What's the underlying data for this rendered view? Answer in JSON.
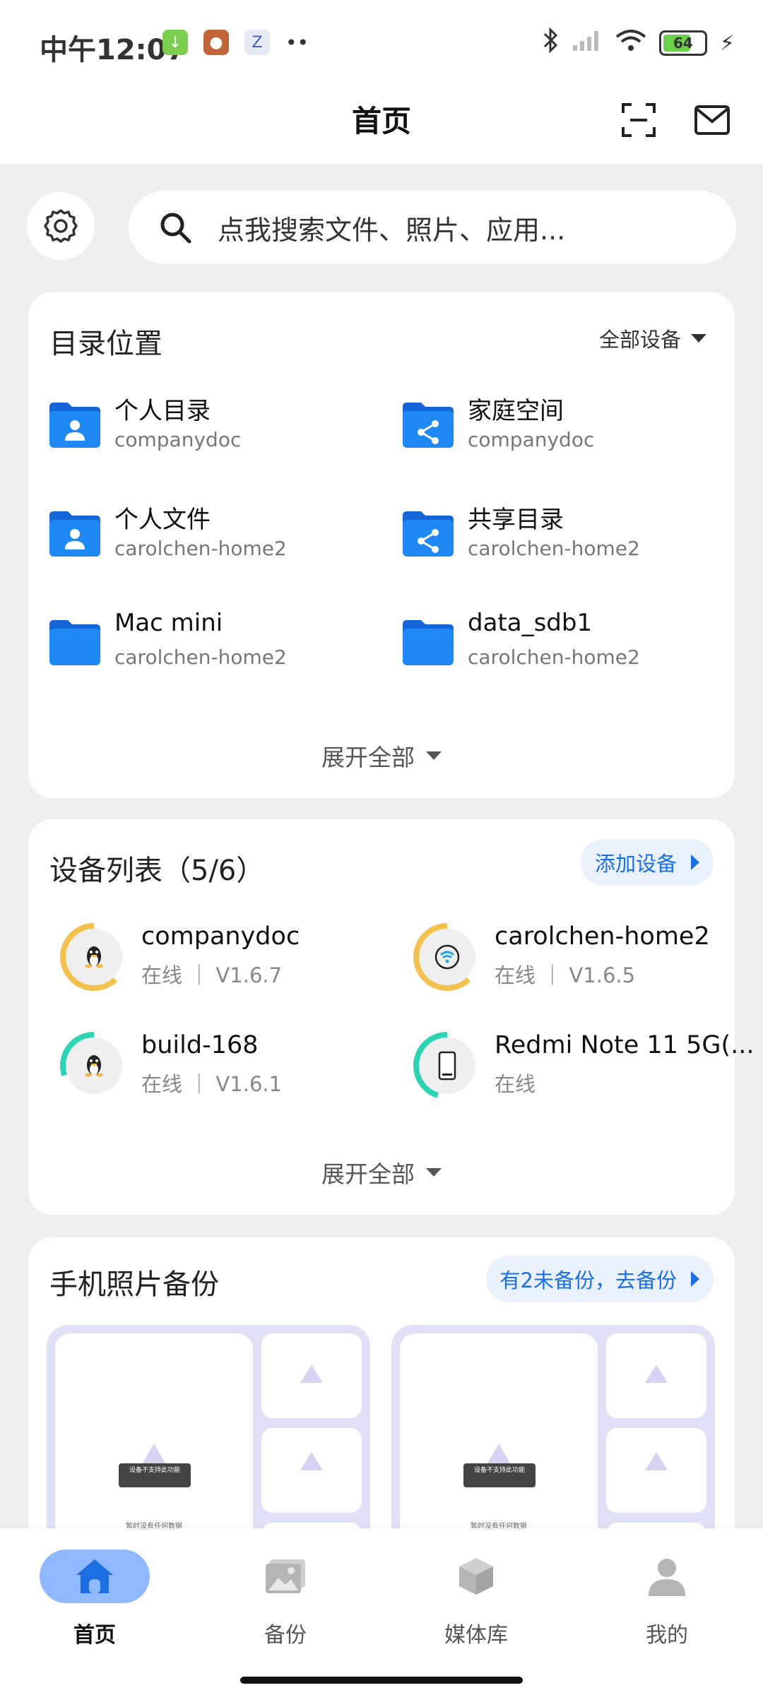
{
  "status_bar": {
    "time": "中午12:07",
    "battery": "64"
  },
  "header": {
    "title": "首页"
  },
  "search": {
    "placeholder": "点我搜索文件、照片、应用..."
  },
  "directory_card": {
    "title": "目录位置",
    "filter_label": "全部设备",
    "items": [
      {
        "name": "个人目录",
        "device": "companydoc",
        "icon": "user-folder-icon"
      },
      {
        "name": "家庭空间",
        "device": "companydoc",
        "icon": "share-folder-icon"
      },
      {
        "name": "个人文件",
        "device": "carolchen-home2",
        "icon": "user-folder-icon"
      },
      {
        "name": "共享目录",
        "device": "carolchen-home2",
        "icon": "share-folder-icon"
      },
      {
        "name": "Mac mini",
        "device": "carolchen-home2",
        "icon": "folder-icon"
      },
      {
        "name": "data_sdb1",
        "device": "carolchen-home2",
        "icon": "folder-icon"
      }
    ],
    "expand_label": "展开全部"
  },
  "device_card": {
    "title": "设备列表（5/6）",
    "add_label": "添加设备",
    "items": [
      {
        "name": "companydoc",
        "status": "在线 ｜ V1.6.7",
        "icon": "linux-icon",
        "usage": 0.62,
        "ring_color": "#f2c14e"
      },
      {
        "name": "carolchen-home2",
        "status": "在线 ｜ V1.6.5",
        "icon": "nas-icon",
        "usage": 0.62,
        "ring_color": "#f2c14e"
      },
      {
        "name": "build-168",
        "status": "在线 ｜ V1.6.1",
        "icon": "linux-icon",
        "usage": 0.3,
        "ring_color": "#2dd4b4"
      },
      {
        "name": "Redmi Note 11 5G(...",
        "status": "在线",
        "icon": "phone-icon",
        "usage": 0.45,
        "ring_color": "#2dd4b4"
      }
    ],
    "expand_label": "展开全部"
  },
  "photo_card": {
    "title": "手机照片备份",
    "action_label": "有2未备份，去备份",
    "toast_text": "设备不支持此功能",
    "empty_text": "暂时没有任何数据"
  },
  "bottom_nav": {
    "items": [
      {
        "label": "首页",
        "icon": "home-icon",
        "active": true
      },
      {
        "label": "备份",
        "icon": "image-icon",
        "active": false
      },
      {
        "label": "媒体库",
        "icon": "cube-icon",
        "active": false
      },
      {
        "label": "我的",
        "icon": "person-icon",
        "active": false
      }
    ]
  },
  "colors": {
    "accent": "#1b6fe0",
    "folder_blue": "#1e88f5",
    "active_nav_bg": "#8fb8ff"
  }
}
